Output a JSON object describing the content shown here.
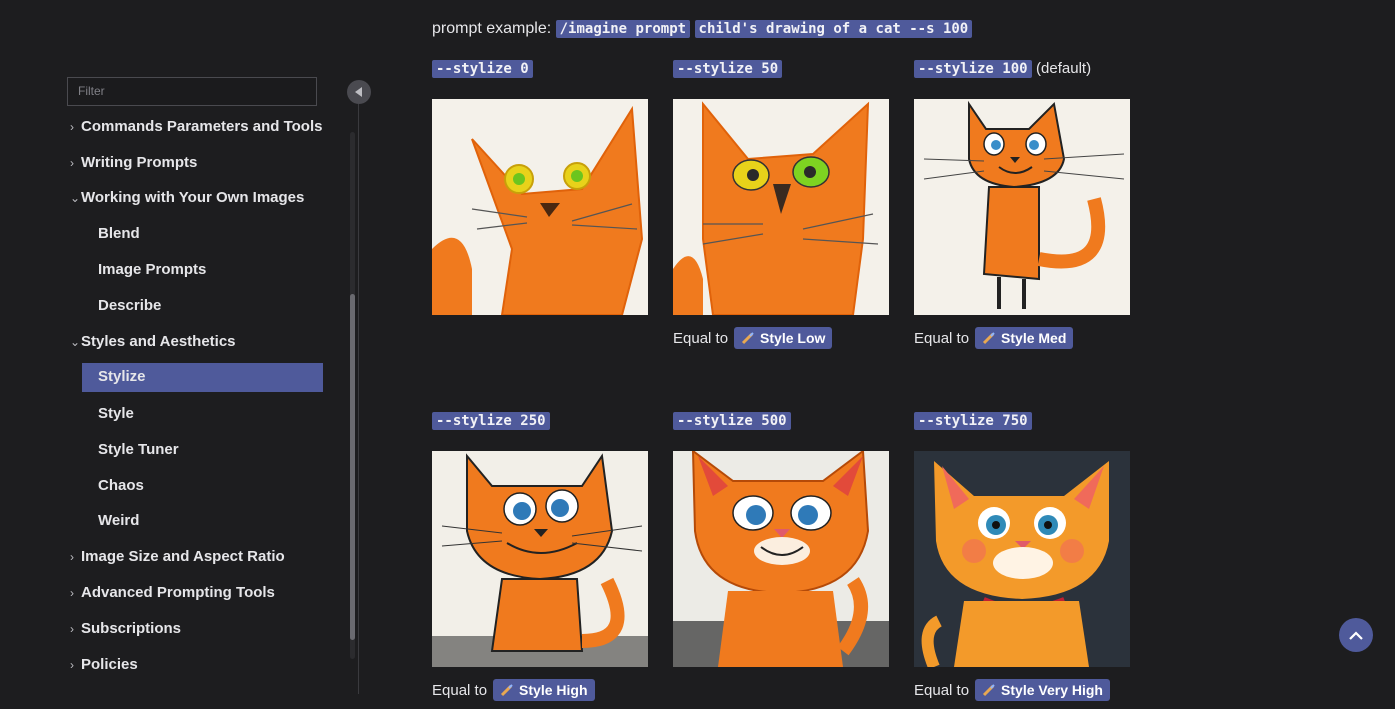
{
  "sidebar": {
    "filter_placeholder": "Filter",
    "items": [
      {
        "label": "Commands Parameters and Tools",
        "level": "top",
        "expanded": false
      },
      {
        "label": "Writing Prompts",
        "level": "top",
        "expanded": false
      },
      {
        "label": "Working with Your Own Images",
        "level": "top",
        "expanded": true
      },
      {
        "label": "Blend",
        "level": "sub"
      },
      {
        "label": "Image Prompts",
        "level": "sub"
      },
      {
        "label": "Describe",
        "level": "sub"
      },
      {
        "label": "Styles and Aesthetics",
        "level": "top",
        "expanded": true
      },
      {
        "label": "Stylize",
        "level": "sub",
        "active": true
      },
      {
        "label": "Style",
        "level": "sub"
      },
      {
        "label": "Style Tuner",
        "level": "sub"
      },
      {
        "label": "Chaos",
        "level": "sub"
      },
      {
        "label": "Weird",
        "level": "sub"
      },
      {
        "label": "Image Size and Aspect Ratio",
        "level": "top",
        "expanded": false
      },
      {
        "label": "Advanced Prompting Tools",
        "level": "top",
        "expanded": false
      },
      {
        "label": "Subscriptions",
        "level": "top",
        "expanded": false
      },
      {
        "label": "Policies",
        "level": "top",
        "expanded": false
      }
    ]
  },
  "main": {
    "prompt_label": "prompt example:",
    "prompt_cmd": "/imagine prompt",
    "prompt_text": "child's drawing of a cat --s 100",
    "cells": [
      {
        "param": "--stylize 0",
        "note": "",
        "equal_label": "",
        "style": ""
      },
      {
        "param": "--stylize 50",
        "note": "",
        "equal_label": "Equal to",
        "style": "Style Low"
      },
      {
        "param": "--stylize 100",
        "note": "(default)",
        "equal_label": "Equal to",
        "style": "Style Med"
      },
      {
        "param": "--stylize 250",
        "note": "",
        "equal_label": "Equal to",
        "style": "Style High"
      },
      {
        "param": "--stylize 500",
        "note": "",
        "equal_label": "",
        "style": ""
      },
      {
        "param": "--stylize 750",
        "note": "",
        "equal_label": "Equal to",
        "style": "Style Very High"
      }
    ]
  },
  "colors": {
    "accent": "#4f5a9b",
    "background": "#1d1d1f",
    "cat_orange": "#f07a1e"
  },
  "icons": {
    "collapse": "chevron-left-icon",
    "expand": "chevron-right-icon",
    "expanded": "chevron-down-icon",
    "style_badge": "paintbrush-icon",
    "scroll_top": "chevron-up-icon"
  }
}
